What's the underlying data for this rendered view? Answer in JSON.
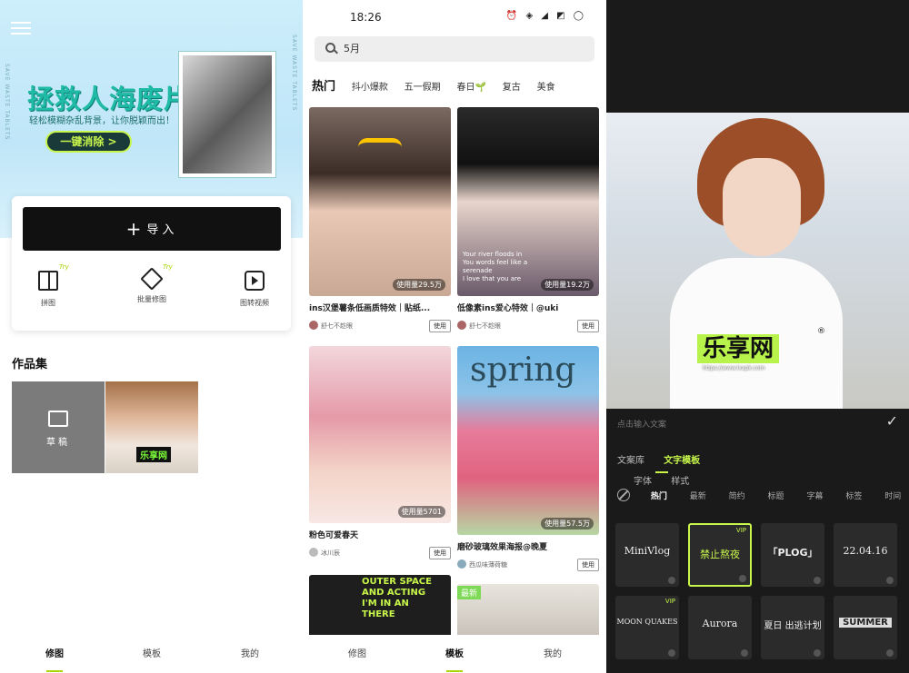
{
  "panel1": {
    "banner": {
      "title": "拯救人海废片",
      "subtitle": "轻松模糊杂乱背景，让你脱颖而出！",
      "button": "一键消除 >",
      "side_text": "SAVE WASTE TABLETS"
    },
    "import_button": "导入",
    "tools": [
      {
        "label": "拼图",
        "icon": "collage-icon",
        "badge": ""
      },
      {
        "label": "批量修图",
        "icon": "batch-edit-icon",
        "badge": "Try"
      },
      {
        "label": "图转视频",
        "icon": "image-to-video-icon",
        "badge": ""
      }
    ],
    "tool_badge_first": "Try",
    "section_title": "作品集",
    "draft_label": "草稿",
    "work_badge": "乐享网",
    "tabs": [
      "修图",
      "模板",
      "我的"
    ],
    "active_tab": "修图"
  },
  "panel2": {
    "status": {
      "time": "18:26",
      "icons": "⏰ ◈ ◢ ◩ ◯"
    },
    "search": {
      "value": "5月"
    },
    "categories": [
      "热门",
      "抖小爆款",
      "五一假期",
      "春日🌱",
      "复古",
      "美食"
    ],
    "tiles": [
      {
        "caption": "ins汉堡薯条低画质特效｜贴纸...",
        "author": "舒七不趁眼",
        "usage": "使用量29.5万",
        "button": "使用"
      },
      {
        "caption": "低像素ins爱心特效｜@uki",
        "author": "舒七不趁眼",
        "usage": "使用量19.2万",
        "button": "使用",
        "overlay": "Your river floods in\nYou words feel like a\nserenade\nI love that you are\n"
      },
      {
        "caption": "粉色可爱春天",
        "author": "冰川辰",
        "usage": "使用量5701",
        "button": "使用"
      },
      {
        "caption": "磨砂玻璃效果海报@晚夏",
        "author": "西瓜味薄荷糖",
        "usage": "使用量57.5万",
        "button": "使用",
        "overlay": "spring"
      },
      {
        "caption": "",
        "author": "",
        "usage": "",
        "button": "",
        "overlay": "OUTER SPACE\nAND ACTING\nI'M IN AN\nTHERE"
      },
      {
        "caption": "",
        "author": "",
        "usage": "",
        "button": "",
        "badge": "最新"
      }
    ],
    "tabs": [
      "修图",
      "模板",
      "我的"
    ],
    "active_tab": "模板"
  },
  "panel3": {
    "watermark": "乐享网",
    "watermark_url": "https://www.lxapk.com",
    "input_placeholder": "点击输入文案",
    "main_tabs": [
      "文案库",
      "文字模板",
      "字体",
      "样式"
    ],
    "active_main_tab": "文字模板",
    "sub_tabs": [
      "热门",
      "最新",
      "简约",
      "标题",
      "字幕",
      "标签",
      "时间"
    ],
    "active_sub_tab": "热门",
    "templates": [
      {
        "text": "MiniVlog",
        "vip": false
      },
      {
        "text": "禁止熬夜",
        "vip": true
      },
      {
        "text": "「PLOG」",
        "vip": false
      },
      {
        "text": "22.04.16",
        "vip": false
      },
      {
        "text": "MOON QUAKES",
        "vip": true
      },
      {
        "text": "Aurora",
        "vip": false
      },
      {
        "text": "夏日 出逃计划",
        "vip": false
      },
      {
        "text": "SUMMER",
        "vip": false
      }
    ],
    "vip_label": "VIP",
    "colors": {
      "accent": "#c7f54a",
      "dark_bg": "#1a1a1a"
    }
  }
}
